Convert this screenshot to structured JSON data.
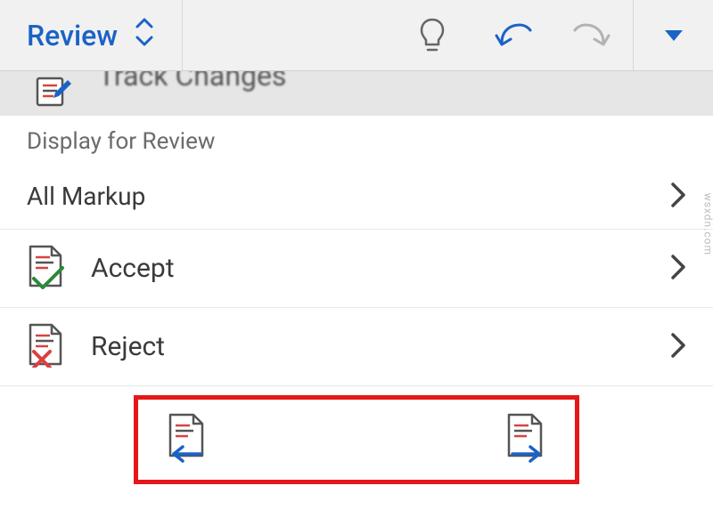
{
  "toolbar": {
    "tab_label": "Review"
  },
  "track_changes": {
    "label": "Track Changes"
  },
  "display_for_review": {
    "label": "Display for Review",
    "current": "All Markup"
  },
  "actions": {
    "accept": "Accept",
    "reject": "Reject"
  },
  "watermark": "wsxdn.com"
}
